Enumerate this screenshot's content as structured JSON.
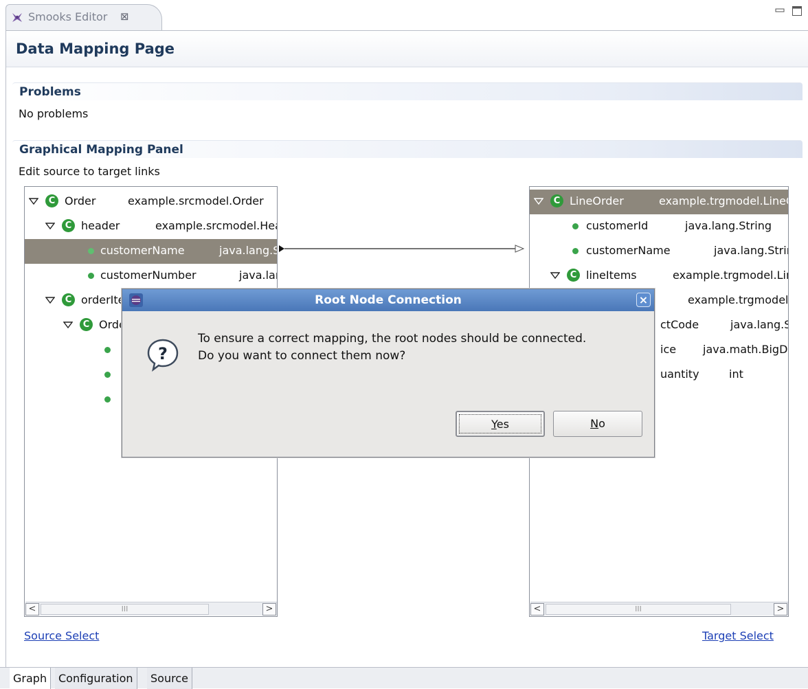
{
  "editor_tab": {
    "label": "Smooks Editor",
    "close_glyph": "⊠",
    "icon": "smooks-logo-icon"
  },
  "window_controls": {
    "minimize": "minimize-icon",
    "maximize": "maximize-icon"
  },
  "page": {
    "title": "Data Mapping Page"
  },
  "problems": {
    "title": "Problems",
    "text": "No problems"
  },
  "mapping_panel": {
    "title": "Graphical Mapping Panel",
    "description": "Edit source to target links"
  },
  "source_tree": {
    "rows": [
      {
        "name": "Order",
        "type": "example.srcmodel.Order"
      },
      {
        "name": "header",
        "type": "example.srcmodel.Header"
      },
      {
        "name": "customerName",
        "type": "java.lang.String"
      },
      {
        "name": "customerNumber",
        "type": "java.lang.Integer"
      },
      {
        "name": "orderItems",
        "type": ""
      },
      {
        "name": "OrderItem",
        "type": ""
      }
    ]
  },
  "target_tree": {
    "rows": [
      {
        "name": "LineOrder",
        "type": "example.trgmodel.LineOrder"
      },
      {
        "name": "customerId",
        "type": "java.lang.String"
      },
      {
        "name": "customerName",
        "type": "java.lang.String"
      },
      {
        "name": "lineItems",
        "type": "example.trgmodel.LineItem[]"
      },
      {
        "name": "",
        "type": "example.trgmodel.LineItem"
      },
      {
        "name": "ctCode",
        "type": "java.lang.String"
      },
      {
        "name": "ice",
        "type": "java.math.BigDecimal"
      },
      {
        "name": "uantity",
        "type": "int"
      }
    ]
  },
  "scrollbar": {
    "left_arrow": "<",
    "right_arrow": ">",
    "thumb_grip": "III"
  },
  "links": {
    "source_select": "Source Select",
    "target_select": "Target Select"
  },
  "bottom_tabs": [
    "Graph",
    "Configuration",
    "Source"
  ],
  "dialog": {
    "title": "Root Node Connection",
    "close_glyph": "×",
    "message_line1": "To ensure a correct mapping, the root nodes should be connected.",
    "message_line2": "Do you want to connect them now?",
    "yes_mnemonic": "Y",
    "yes_rest": "es",
    "no_mnemonic": "N",
    "no_rest": "o"
  },
  "colors": {
    "selection": "#8d877c",
    "class_icon": "#2f9a3a",
    "link": "#1c3fb5",
    "dialog_title_bar": "#4a77b8"
  }
}
